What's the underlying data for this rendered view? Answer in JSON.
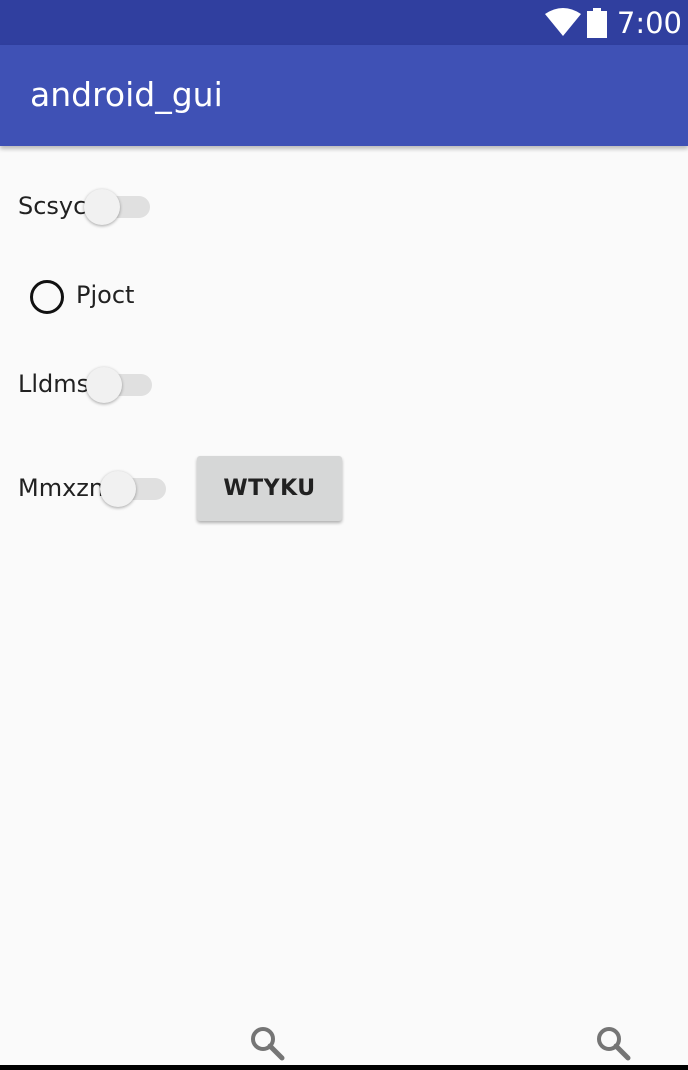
{
  "status_bar": {
    "time": "7:00",
    "icons": [
      "wifi-icon",
      "battery-icon"
    ],
    "color": "#303f9f"
  },
  "app_bar": {
    "title": "android_gui",
    "color": "#3f51b5"
  },
  "controls": {
    "switch_1": {
      "label": "Scsyc",
      "checked": false
    },
    "radio_1": {
      "label": "Pjoct",
      "checked": false
    },
    "switch_2": {
      "label": "Lldms",
      "checked": false
    },
    "switch_3": {
      "label": "Mmxzn",
      "checked": false
    },
    "button_1": {
      "label": "WTYKU"
    }
  },
  "bottom_icons": [
    "search-icon",
    "search-icon"
  ]
}
